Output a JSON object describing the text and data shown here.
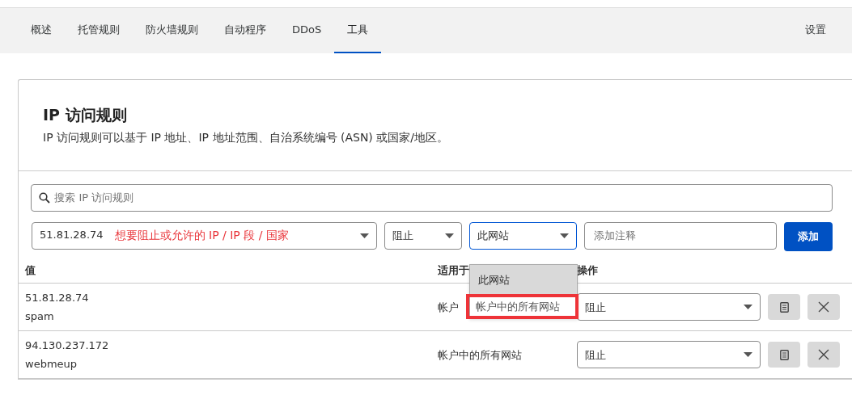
{
  "tabs": [
    {
      "label": "概述",
      "selected": false
    },
    {
      "label": "托管规则",
      "selected": false
    },
    {
      "label": "防火墙规则",
      "selected": false
    },
    {
      "label": "自动程序",
      "selected": false
    },
    {
      "label": "DDoS",
      "selected": false
    },
    {
      "label": "工具",
      "selected": true
    }
  ],
  "settings_link": "设置",
  "card": {
    "title": "IP 访问规则",
    "description": "IP 访问规则可以基于 IP 地址、IP 地址范围、自治系统编号 (ASN) 或国家/地区。"
  },
  "search": {
    "placeholder": "搜索 IP 访问规则"
  },
  "form": {
    "value": "51.81.28.74",
    "annotation": "想要阻止或允许的 IP / IP 段 / 国家",
    "action": "阻止",
    "scope": "此网站",
    "note_placeholder": "添加注释",
    "add_button": "添加"
  },
  "scope_dropdown": {
    "options": [
      {
        "label": "此网站",
        "selected": true,
        "highlighted": false
      },
      {
        "label": "帐户中的所有网站",
        "selected": false,
        "highlighted": true
      }
    ]
  },
  "table": {
    "columns": [
      "值",
      "适用于",
      "操作"
    ],
    "rows": [
      {
        "value": "51.81.28.74",
        "note": "spam",
        "scope": "帐户",
        "action": "阻止"
      },
      {
        "value": "94.130.237.172",
        "note": "webmeup",
        "scope": "帐户中的所有网站",
        "action": "阻止"
      }
    ]
  }
}
